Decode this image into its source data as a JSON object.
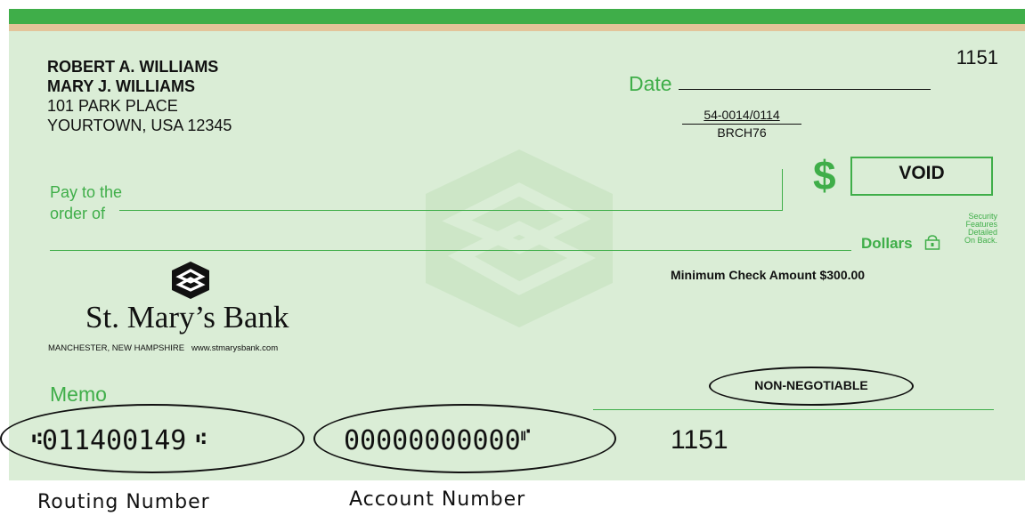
{
  "check_number_top": "1151",
  "owner": {
    "line1": "ROBERT A. WILLIAMS",
    "line2": "MARY J. WILLIAMS",
    "line3": "101 PARK PLACE",
    "line4": "YOURTOWN, USA  12345"
  },
  "date_label": "Date",
  "fraction": {
    "top": "54-0014/0114",
    "bottom": "BRCH76"
  },
  "dollar_sign": "$",
  "amount_box": "VOID",
  "pay_to_line1": "Pay to the",
  "pay_to_line2": "order of",
  "dollars_label": "Dollars",
  "security_text": [
    "Security",
    "Features",
    "Detailed",
    "On Back."
  ],
  "minimum_amount": "Minimum Check Amount $300.00",
  "bank": {
    "name": "St. Mary’s Bank",
    "location": "MANCHESTER, NEW HAMPSHIRE",
    "website": "www.stmarysbank.com"
  },
  "memo_label": "Memo",
  "non_negotiable": "NON-NEGOTIABLE",
  "micr": {
    "routing": "011400149",
    "account": "00000000000",
    "check_number": "1151"
  },
  "captions": {
    "routing": "Routing Number",
    "account": "Account Number"
  },
  "colors": {
    "check_bg": "#daedd6",
    "accent_green": "#3fae49",
    "tan_band": "#e3c49a"
  }
}
